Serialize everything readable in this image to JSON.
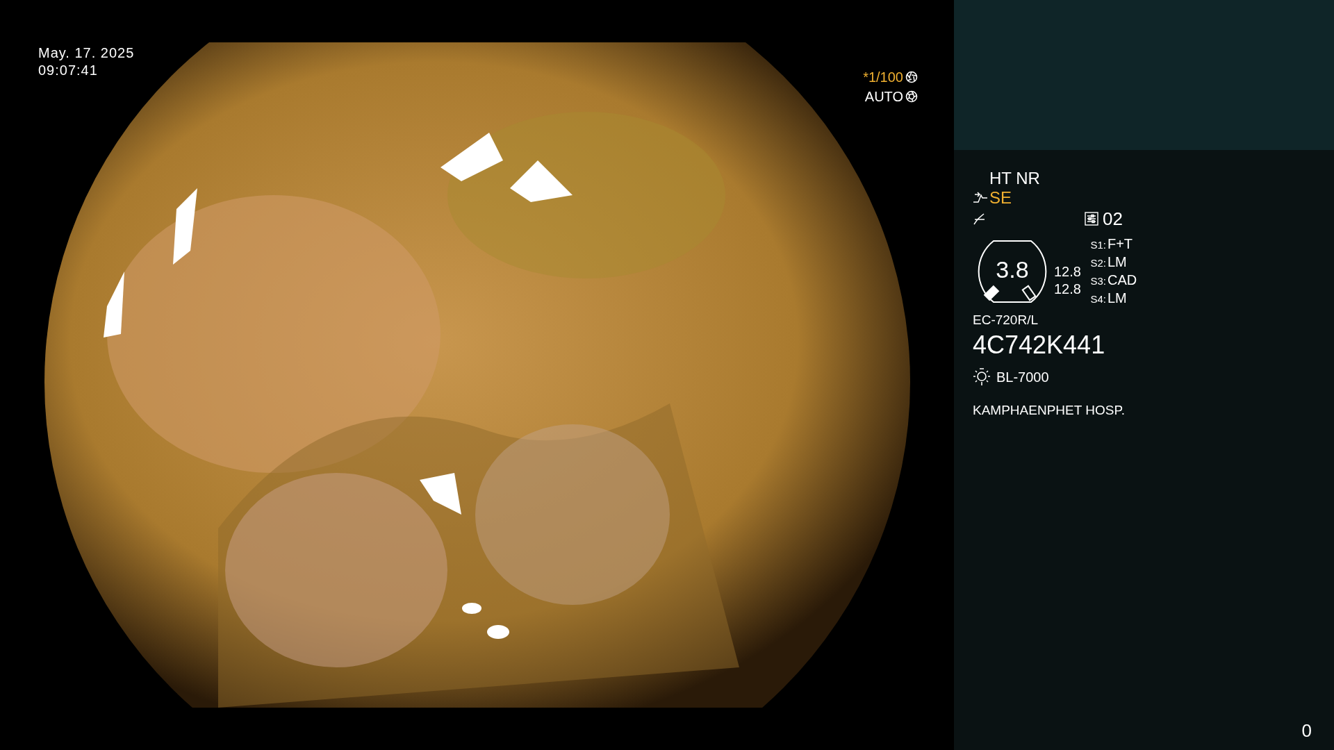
{
  "overlay": {
    "date": "May. 17. 2025",
    "time": "09:07:41",
    "shutter": "*1/100",
    "iris": "AUTO"
  },
  "panel": {
    "processing": "HT NR",
    "enhancement": "SE",
    "preset": "02",
    "gauge": "3.8",
    "readings": [
      "12.8",
      "12.8"
    ],
    "switches": [
      {
        "label": "S1:",
        "value": "F+T"
      },
      {
        "label": "S2:",
        "value": "LM"
      },
      {
        "label": "S3:",
        "value": "CAD"
      },
      {
        "label": "S4:",
        "value": "LM"
      }
    ],
    "scope_model": "EC-720R/L",
    "scope_serial": "4C742K441",
    "light_source": "BL-7000",
    "hospital": "KAMPHAENPHET HOSP.",
    "counter": "0"
  }
}
